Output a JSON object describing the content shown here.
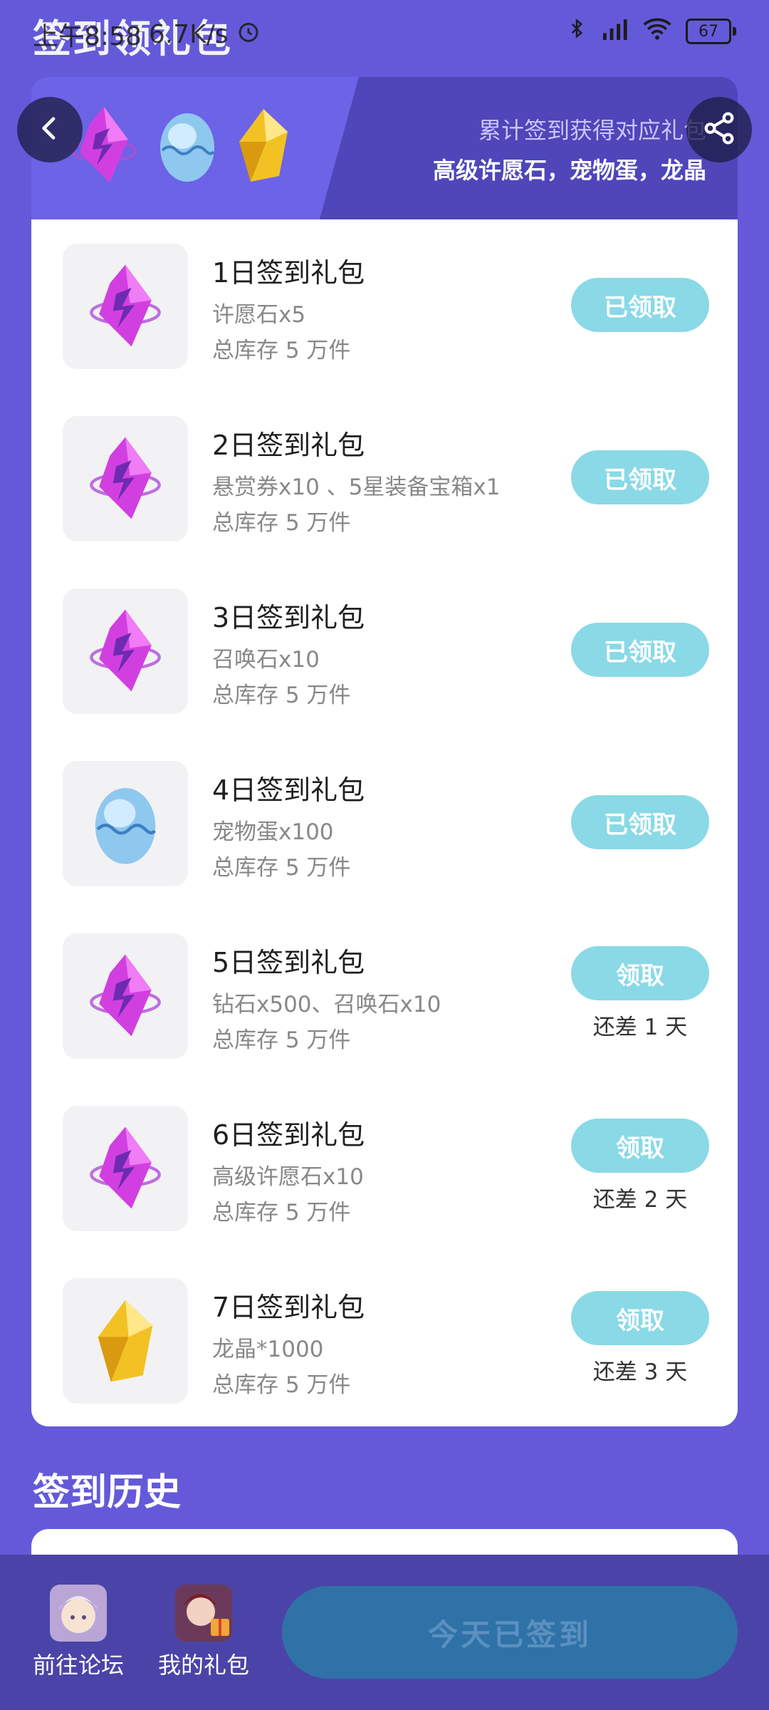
{
  "page": {
    "title": "签到领礼包"
  },
  "status_bar": {
    "time": "上午8:58",
    "speed": "6.7K/s",
    "battery": "67"
  },
  "banner": {
    "subtitle": "累计签到获得对应礼包",
    "main": "高级许愿石，宠物蛋，龙晶",
    "icons": [
      "purple-crystal-icon",
      "pet-egg-icon",
      "dragon-crystal-icon"
    ]
  },
  "gifts": [
    {
      "title": "1日签到礼包",
      "desc": "许愿石x5",
      "stock": "总库存 5 万件",
      "button": "已领取",
      "remain": "",
      "icon": "purple-crystal-icon"
    },
    {
      "title": "2日签到礼包",
      "desc": "悬赏券x10 、5星装备宝箱x1",
      "stock": "总库存 5 万件",
      "button": "已领取",
      "remain": "",
      "icon": "purple-crystal-icon"
    },
    {
      "title": "3日签到礼包",
      "desc": "召唤石x10",
      "stock": "总库存 5 万件",
      "button": "已领取",
      "remain": "",
      "icon": "purple-crystal-icon"
    },
    {
      "title": "4日签到礼包",
      "desc": "宠物蛋x100",
      "stock": "总库存 5 万件",
      "button": "已领取",
      "remain": "",
      "icon": "pet-egg-icon"
    },
    {
      "title": "5日签到礼包",
      "desc": "钻石x500、召唤石x10",
      "stock": "总库存 5 万件",
      "button": "领取",
      "remain": "还差 1 天",
      "icon": "purple-crystal-icon"
    },
    {
      "title": "6日签到礼包",
      "desc": "高级许愿石x10",
      "stock": "总库存 5 万件",
      "button": "领取",
      "remain": "还差 2 天",
      "icon": "purple-crystal-icon"
    },
    {
      "title": "7日签到礼包",
      "desc": "龙晶*1000",
      "stock": "总库存 5 万件",
      "button": "领取",
      "remain": "还差 3 天",
      "icon": "dragon-crystal-icon"
    }
  ],
  "history": {
    "title": "签到历史"
  },
  "bottom": {
    "forum": "前往论坛",
    "my_gifts": "我的礼包",
    "sign_button": "今天已签到"
  },
  "colors": {
    "background": "#645ad9",
    "button": "#8ad9e6",
    "bottom_bar": "#4b44a8",
    "sign_button": "#2f72a8"
  }
}
